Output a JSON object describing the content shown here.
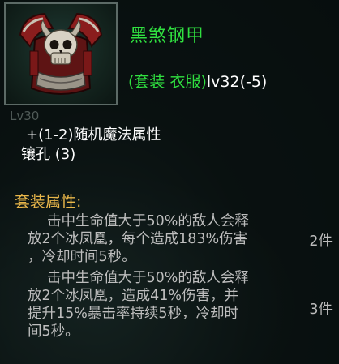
{
  "item": {
    "name": "黑煞钢甲",
    "type_prefix": "(套装 衣服)",
    "level": "lv32(-5)",
    "icon_level": "Lv30",
    "icon_name": "skull-chest-armor-icon"
  },
  "stats": [
    "+(1-2)随机魔法属性",
    "镶孔 (3)"
  ],
  "set": {
    "title": "套装属性:",
    "effects": [
      {
        "lines": [
          "击中生命值大于50%的敌人会释",
          "放2个冰凤凰，每个造成183%伤害",
          "，冷却时间5秒。"
        ],
        "count": "2件"
      },
      {
        "lines": [
          "击中生命值大于50%的敌人会释",
          "放2个冰凤凰，造成41%伤害，并",
          "提升15%暴击率持续5秒，冷却时",
          "间5秒。"
        ],
        "count": "3件"
      }
    ]
  },
  "colors": {
    "name_green": "#30e040",
    "set_title_gold": "#e8b64a",
    "effect_gray": "#bdbdbd"
  }
}
